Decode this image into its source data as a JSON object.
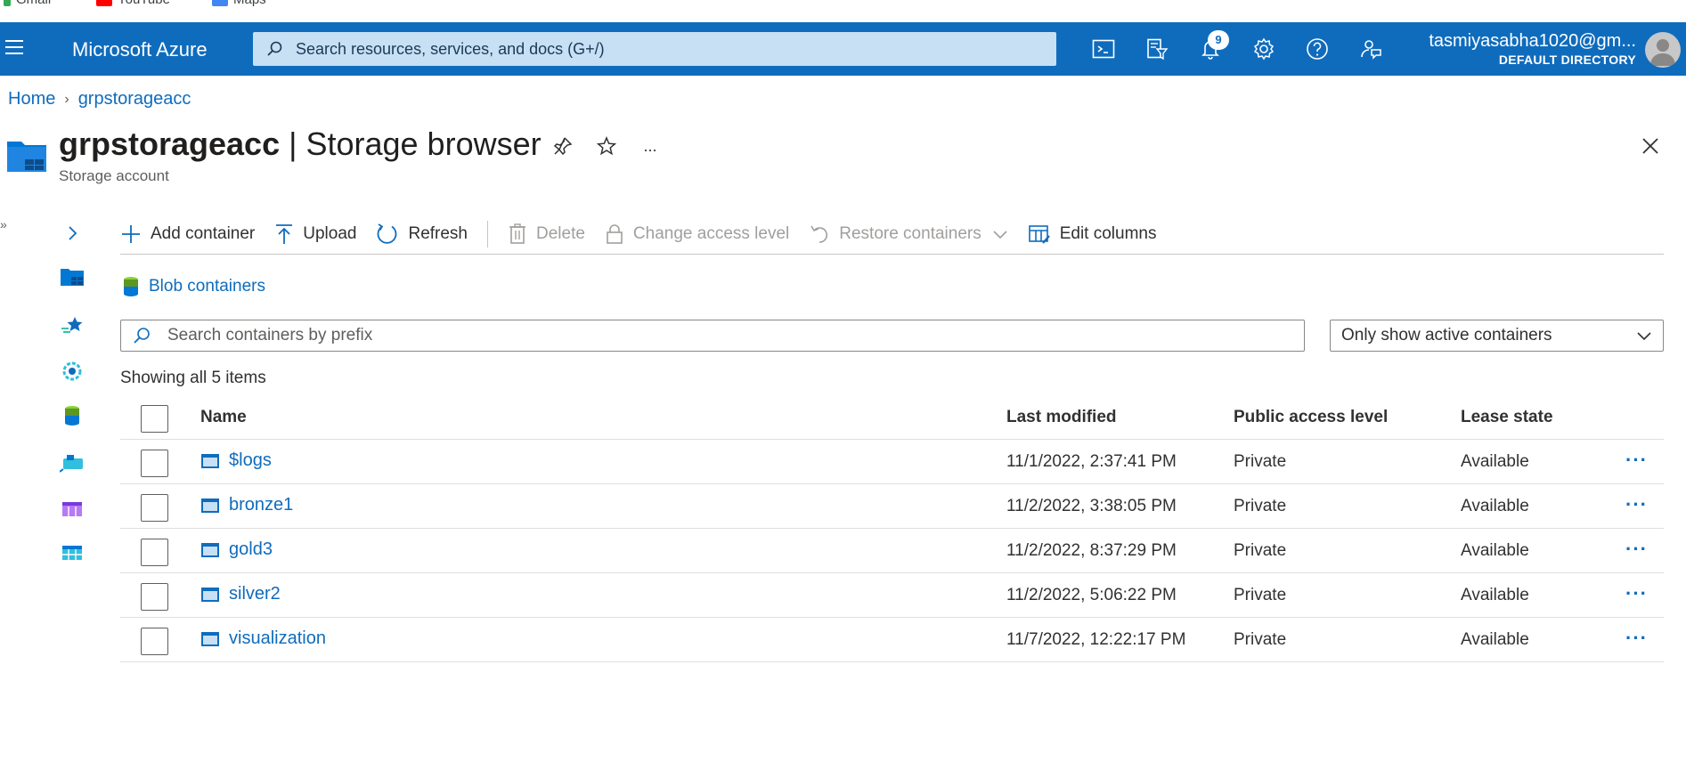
{
  "bookmarks": [
    {
      "label": "Gmail",
      "color": "#34a853"
    },
    {
      "label": "YouTube",
      "color": "#ff0000"
    },
    {
      "label": "Maps",
      "color": "#4285f4"
    }
  ],
  "topbar": {
    "brand": "Microsoft Azure",
    "search_placeholder": "Search resources, services, and docs (G+/)",
    "notification_count": "9",
    "icons": [
      "cloud-shell-icon",
      "directory-filter-icon",
      "notifications-icon",
      "settings-icon",
      "help-icon",
      "feedback-icon"
    ],
    "user_email": "tasmiyasabha1020@gm...",
    "user_directory": "DEFAULT DIRECTORY",
    "accent": "#0f6cbd"
  },
  "breadcrumb": {
    "home": "Home",
    "resource": "grpstorageacc"
  },
  "header": {
    "resource_name": "grpstorageacc",
    "separator": " | ",
    "blade_name": "Storage browser",
    "subtitle": "Storage account",
    "more": "..."
  },
  "rail_icons": [
    "storage-account-icon",
    "favorites-icon",
    "recent-icon",
    "blob-containers-icon",
    "file-shares-icon",
    "queues-icon",
    "tables-icon"
  ],
  "commands": {
    "add_container": "Add container",
    "upload": "Upload",
    "refresh": "Refresh",
    "delete": "Delete",
    "change_access": "Change access level",
    "restore": "Restore containers",
    "edit_columns": "Edit columns"
  },
  "section": {
    "label": "Blob containers"
  },
  "filters": {
    "prefix_placeholder": "Search containers by prefix",
    "status_filter": "Only show active containers"
  },
  "count_text": "Showing all 5 items",
  "table": {
    "columns": {
      "name": "Name",
      "modified": "Last modified",
      "access": "Public access level",
      "lease": "Lease state"
    },
    "rows": [
      {
        "name": "$logs",
        "modified": "11/1/2022, 2:37:41 PM",
        "access": "Private",
        "lease": "Available"
      },
      {
        "name": "bronze1",
        "modified": "11/2/2022, 3:38:05 PM",
        "access": "Private",
        "lease": "Available"
      },
      {
        "name": "gold3",
        "modified": "11/2/2022, 8:37:29 PM",
        "access": "Private",
        "lease": "Available"
      },
      {
        "name": "silver2",
        "modified": "11/2/2022, 5:06:22 PM",
        "access": "Private",
        "lease": "Available"
      },
      {
        "name": "visualization",
        "modified": "11/7/2022, 12:22:17 PM",
        "access": "Private",
        "lease": "Available"
      }
    ],
    "row_more": "···"
  }
}
